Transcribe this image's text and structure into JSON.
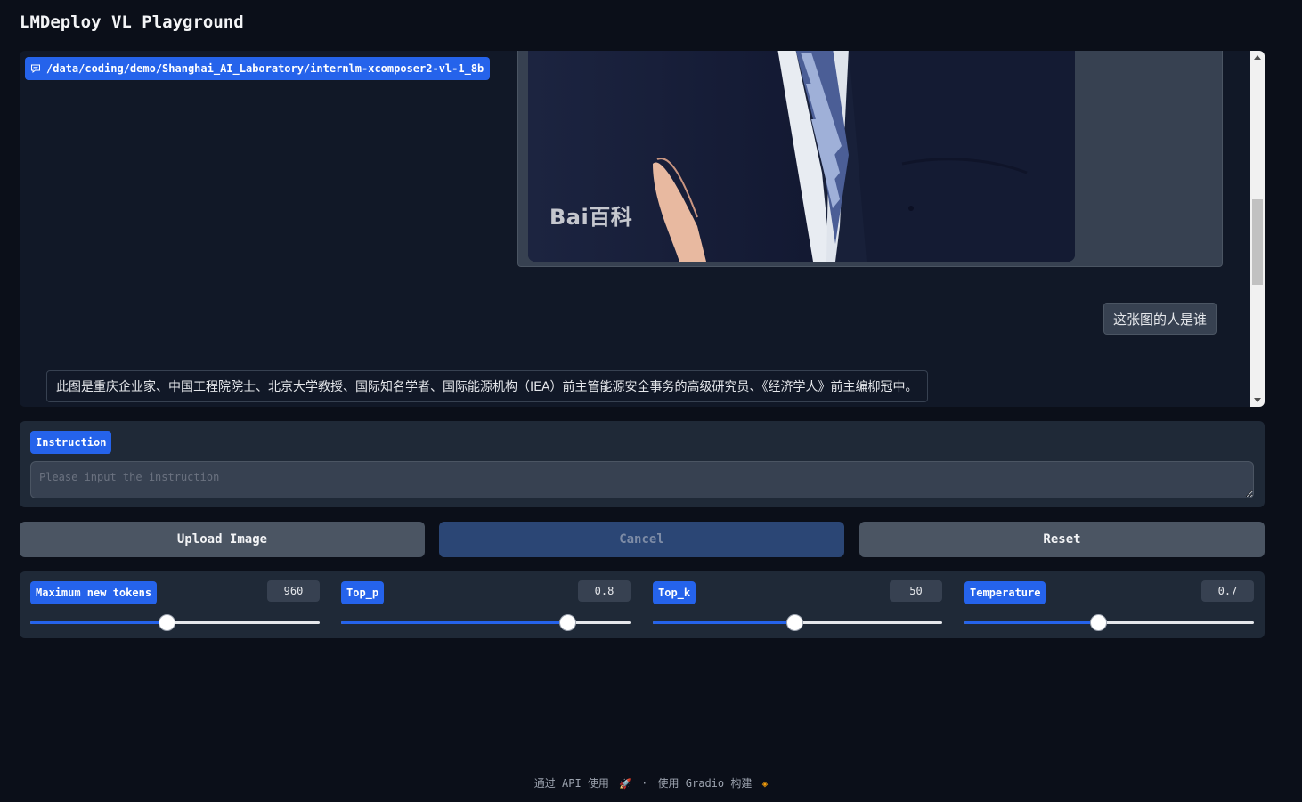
{
  "app": {
    "title": "LMDeploy VL Playground"
  },
  "chatbot": {
    "label": "/data/coding/demo/Shanghai_AI_Laboratory/internlm-xcomposer2-vl-1_8b",
    "label_icon": "chat-bubble-icon",
    "image_watermark": "Bai百科",
    "user_message": "这张图的人是谁",
    "bot_message": "此图是重庆企业家、中国工程院院士、北京大学教授、国际知名学者、国际能源机构（IEA）前主管能源安全事务的高级研究员、《经济学人》前主编柳冠中。"
  },
  "instruction": {
    "label": "Instruction",
    "placeholder": "Please input the instruction",
    "value": ""
  },
  "buttons": {
    "upload": "Upload Image",
    "cancel": "Cancel",
    "reset": "Reset"
  },
  "sliders": [
    {
      "label": "Maximum new tokens",
      "value": "960",
      "fraction": 0.47
    },
    {
      "label": "Top_p",
      "value": "0.8",
      "fraction": 0.78
    },
    {
      "label": "Top_k",
      "value": "50",
      "fraction": 0.49
    },
    {
      "label": "Temperature",
      "value": "0.7",
      "fraction": 0.46
    }
  ],
  "footer": {
    "api_text": "通过 API 使用",
    "separator": "·",
    "gradio_text": "使用 Gradio 构建"
  },
  "colors": {
    "accent": "#2563eb",
    "background": "#0b0f19",
    "panel": "#1f2937"
  }
}
